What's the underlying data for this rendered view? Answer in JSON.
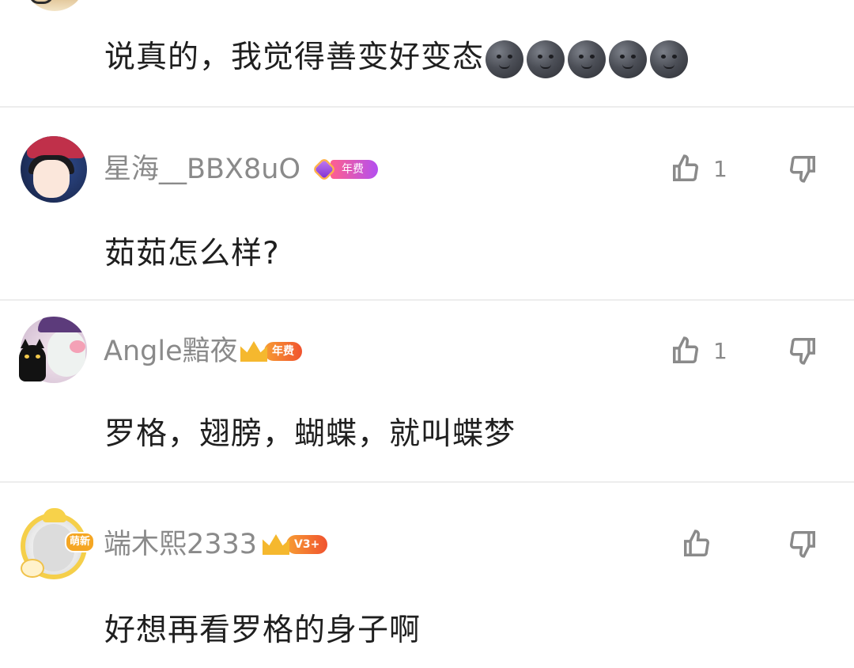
{
  "comments": [
    {
      "text": "说真的，我觉得善变好变态",
      "emoji_count": 5,
      "emoji_name": "new-moon-face-icon"
    },
    {
      "username": "星海__BBX8uO",
      "badge": "年费",
      "text": "茹茹怎么样?",
      "likes": "1"
    },
    {
      "username": "Angle黯夜",
      "badge": "年费",
      "text": "罗格，翅膀，蝴蝶，就叫蝶梦",
      "likes": "1"
    },
    {
      "username": "端木熙2333",
      "badge": "V3+",
      "avatar_tag": "萌新",
      "text": "好想再看罗格的身子啊",
      "likes": ""
    }
  ],
  "colors": {
    "username": "#8a8a8a",
    "text": "#1f1f1f",
    "divider": "#ededed",
    "annual_gradient": [
      "#ff5f8f",
      "#b34ff0"
    ],
    "crown": "#f5b82e"
  }
}
